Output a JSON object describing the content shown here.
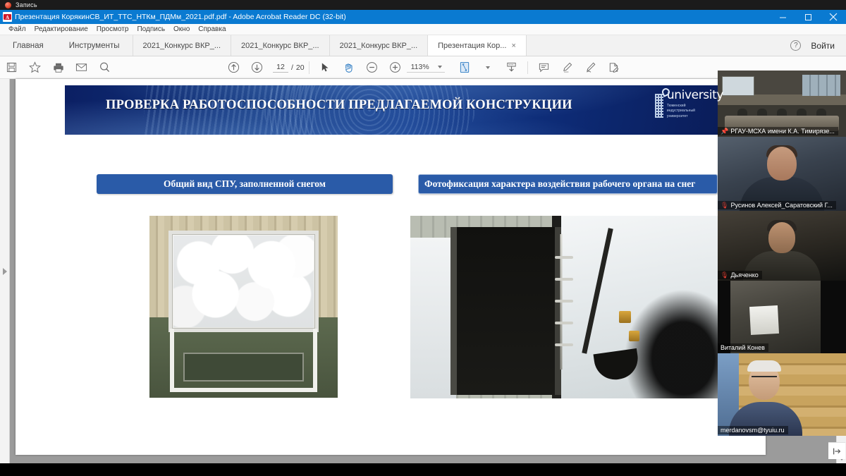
{
  "recording": {
    "label": "Запись"
  },
  "window": {
    "title": "Презентация  КорякинСВ_ИТ_ТТС_НТКм_ПДМм_2021.pdf.pdf - Adobe Acrobat Reader DC (32-bit)",
    "minimize": "—",
    "restore": "□",
    "close": "✕"
  },
  "menu": {
    "items": [
      {
        "label": "Файл"
      },
      {
        "label": "Редактирование"
      },
      {
        "label": "Просмотр"
      },
      {
        "label": "Подпись"
      },
      {
        "label": "Окно"
      },
      {
        "label": "Справка"
      }
    ]
  },
  "tabs": {
    "nav": [
      {
        "label": "Главная"
      },
      {
        "label": "Инструменты"
      }
    ],
    "documents": [
      {
        "label": "2021_Конкурс ВКР_...",
        "active": false
      },
      {
        "label": "2021_Конкурс ВКР_...",
        "active": false
      },
      {
        "label": "2021_Конкурс ВКР_...",
        "active": false
      },
      {
        "label": "Презентация  Кор...",
        "active": true,
        "close": "×"
      }
    ],
    "help_icon": "?",
    "signin_label": "Войти"
  },
  "toolbar": {
    "save_icon": "save-icon",
    "star_icon": "star-icon",
    "print_icon": "print-icon",
    "email_icon": "email-icon",
    "search_icon": "search-icon",
    "page_up_icon": "arrow-up-circle-icon",
    "page_down_icon": "arrow-down-circle-icon",
    "current_page": "12",
    "page_separator": "/",
    "total_pages": "20",
    "select_icon": "cursor-icon",
    "hand_icon": "hand-icon",
    "zoom_out_icon": "zoom-out-icon",
    "zoom_in_icon": "zoom-in-icon",
    "zoom_level": "113%",
    "fit_page_icon": "fit-page-icon",
    "download_icon": "download-icon",
    "comment_icon": "comment-icon",
    "highlight_icon": "highlight-icon",
    "draw_icon": "draw-icon",
    "sign_icon": "sign-icon"
  },
  "slide": {
    "title": "ПРОВЕРКА РАБОТОСПОСОБНОСТИ ПРЕДЛАГАЕМОЙ КОНСТРУКЦИИ",
    "logo": {
      "name": "university",
      "subtitle": "Тюменский\nиндустриальный\nуниверситет"
    },
    "caption_left": "Общий вид СПУ, заполненной снегом",
    "caption_right": "Фотофиксация характера воздействия рабочего органа на снег",
    "photo_left_alt": "Снегоплавильная установка, заполненная снегом",
    "photo_right_alt": "Рабочий орган шнека, воздействующий на снег"
  },
  "video_panel": {
    "participants": [
      {
        "name": "РГАУ-МСХА имени К.А. Тимирязе...",
        "status_icon": "pin-icon",
        "muted": false
      },
      {
        "name": "Русинов Алексей_Саратовский Г...",
        "status_icon": "mic-muted-icon",
        "muted": true
      },
      {
        "name": "Дьяченко",
        "status_icon": "mic-muted-icon",
        "muted": true
      },
      {
        "name": "Виталий Конев",
        "status_icon": "",
        "muted": false
      },
      {
        "name": "merdanovsm@tyuiu.ru",
        "status_icon": "",
        "muted": false
      }
    ]
  },
  "colors": {
    "titlebar": "#0a7ad1",
    "caption_blue": "#2a5ba8",
    "slide_header": "#12367f",
    "muted_red": "#e03c31",
    "active_green": "#37d66b"
  }
}
